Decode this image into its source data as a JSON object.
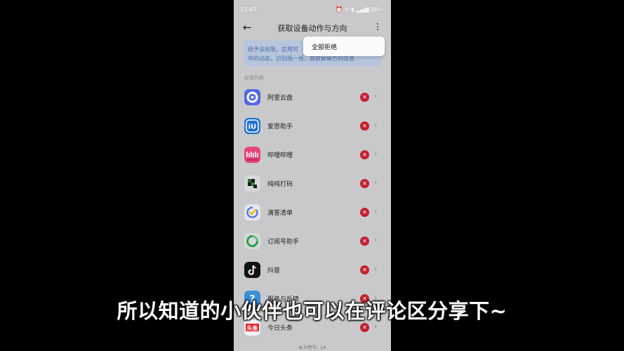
{
  "status": {
    "time": "17:47",
    "icons": "⏰ ✈ ▮ ▂▄▆ 88+"
  },
  "header": {
    "back_icon": "←",
    "title": "获取设备动作与方向"
  },
  "notice": {
    "line1": "授予该权限，应用可",
    "line2": "中的动态，识别摇一摇，获取屏幕方向信息"
  },
  "popup": {
    "deny_all": "全部拒绝"
  },
  "section_label": "应用列表",
  "apps": [
    {
      "name": "阿里云盘",
      "icon": "aliyun-drive-icon"
    },
    {
      "name": "爱思助手",
      "icon": "i4-assistant-icon"
    },
    {
      "name": "哔哩哔哩",
      "icon": "bilibili-icon"
    },
    {
      "name": "纯纯打码",
      "icon": "mosaic-app-icon"
    },
    {
      "name": "滴答清单",
      "icon": "ticktick-icon"
    },
    {
      "name": "订阅号助手",
      "icon": "subscription-assistant-icon"
    },
    {
      "name": "抖音",
      "icon": "douyin-icon"
    },
    {
      "name": "服务与反馈",
      "icon": "service-feedback-icon"
    },
    {
      "name": "今日头条",
      "icon": "toutiao-icon"
    }
  ],
  "deny_glyph": "✕",
  "chevron_glyph": "›",
  "subtitle": "所以知道的小伙伴也可以在评论区分享下~",
  "watermark": "✿ 抖音号：LA",
  "colors": {
    "deny_red": "#c3202e",
    "aliyun_blue": "#5166e8",
    "i4_blue": "#1f6fd6",
    "bilibili_pink": "#e7457b",
    "douyin_black": "#111111",
    "toutiao_red": "#e8272d"
  }
}
